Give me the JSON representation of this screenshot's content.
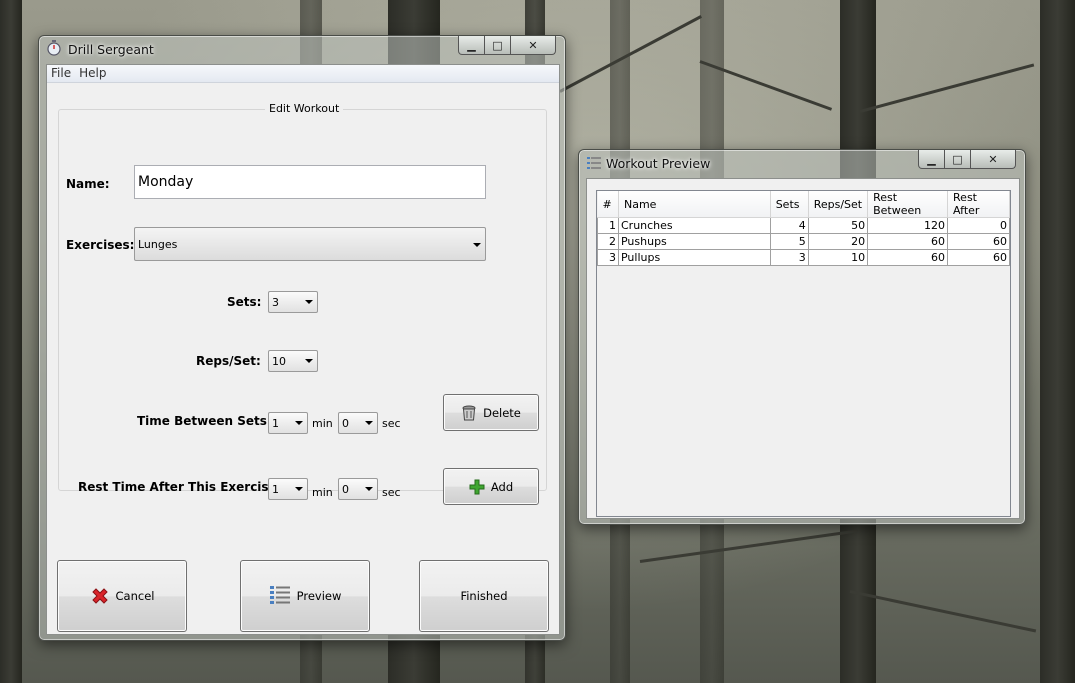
{
  "main_window": {
    "title": "Drill Sergeant",
    "menu": [
      "File",
      "Help"
    ],
    "group_title": "Edit Workout",
    "name_label": "Name:",
    "name_value": "Monday",
    "exercises_label": "Exercises:",
    "exercises_value": "Lunges",
    "sets_label": "Sets:",
    "sets_value": "3",
    "reps_label": "Reps/Set:",
    "reps_value": "10",
    "time_between_label": "Time Between Sets:",
    "time_between_min": "1",
    "time_between_sec": "0",
    "rest_after_label": "Rest Time After This Exercise:",
    "rest_after_min": "1",
    "rest_after_sec": "0",
    "min_unit": "min",
    "sec_unit": "sec",
    "delete_label": "Delete",
    "add_label": "Add",
    "cancel_label": "Cancel",
    "preview_label": "Preview",
    "finished_label": "Finished"
  },
  "preview_window": {
    "title": "Workout Preview",
    "columns": [
      "#",
      "Name",
      "Sets",
      "Reps/Set",
      "Rest Between",
      "Rest After"
    ],
    "rows": [
      [
        "1",
        "Crunches",
        "4",
        "50",
        "120",
        "0"
      ],
      [
        "2",
        "Pushups",
        "5",
        "20",
        "60",
        "60"
      ],
      [
        "3",
        "Pullups",
        "3",
        "10",
        "60",
        "60"
      ]
    ]
  },
  "icons": {
    "app": "stopwatch-icon",
    "delete": "trash-can-icon",
    "add": "green-plus-icon",
    "cancel": "red-x-icon",
    "preview": "list-icon"
  },
  "colors": {
    "add_icon": "#3fa630",
    "cancel_icon": "#d9242a",
    "preview_icon": "#4a7fc0"
  }
}
